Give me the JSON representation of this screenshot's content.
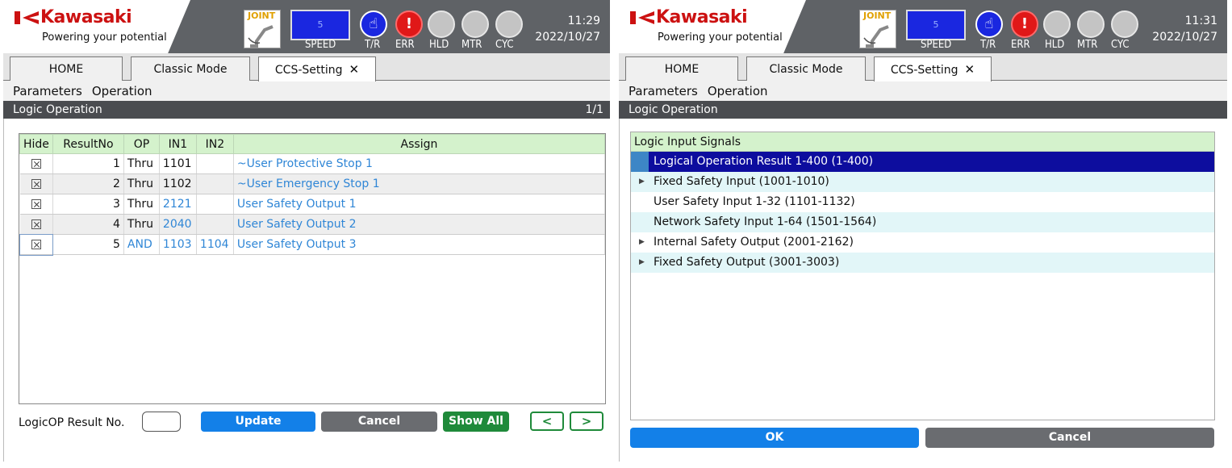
{
  "left": {
    "brand": "Kawasaki",
    "tagline": "Powering your potential",
    "joint_label": "JOINT",
    "speed_value": "5",
    "status_labels": {
      "speed": "SPEED",
      "tr": "T/R",
      "err": "ERR",
      "hld": "HLD",
      "mtr": "MTR",
      "cyc": "CYC"
    },
    "time": "11:29",
    "date": "2022/10/27",
    "tabs": [
      {
        "label": "HOME"
      },
      {
        "label": "Classic Mode"
      },
      {
        "label": "CCS-Setting",
        "close": "✕"
      }
    ],
    "menu": [
      "Parameters",
      "Operation"
    ],
    "section_title": "Logic Operation",
    "page_indicator": "1/1",
    "table": {
      "headers": [
        "Hide",
        "ResultNo",
        "OP",
        "IN1",
        "IN2",
        "Assign"
      ],
      "rows": [
        {
          "result": "1",
          "op": "Thru",
          "in1": "1101",
          "in2": "",
          "assign": "~User Protective Stop 1"
        },
        {
          "result": "2",
          "op": "Thru",
          "in1": "1102",
          "in2": "",
          "assign": "~User Emergency Stop 1"
        },
        {
          "result": "3",
          "op": "Thru",
          "in1": "2121",
          "in2": "",
          "assign": "User Safety Output 1"
        },
        {
          "result": "4",
          "op": "Thru",
          "in1": "2040",
          "in2": "",
          "assign": "User Safety Output 2"
        },
        {
          "result": "5",
          "op": "AND",
          "in1": "1103",
          "in2": "1104",
          "assign": "User Safety Output 3"
        }
      ]
    },
    "result_label": "LogicOP Result No.",
    "result_value": "",
    "buttons": {
      "update": "Update",
      "cancel": "Cancel",
      "show_all": "Show All",
      "prev": "<",
      "next": ">"
    }
  },
  "right": {
    "brand": "Kawasaki",
    "tagline": "Powering your potential",
    "joint_label": "JOINT",
    "speed_value": "5",
    "status_labels": {
      "speed": "SPEED",
      "tr": "T/R",
      "err": "ERR",
      "hld": "HLD",
      "mtr": "MTR",
      "cyc": "CYC"
    },
    "time": "11:31",
    "date": "2022/10/27",
    "tabs": [
      {
        "label": "HOME"
      },
      {
        "label": "Classic Mode"
      },
      {
        "label": "CCS-Setting",
        "close": "✕"
      }
    ],
    "menu": [
      "Parameters",
      "Operation"
    ],
    "section_title": "Logic Operation",
    "tree_title": "Logic Input Signals",
    "tree_items": [
      {
        "label": "Logical Operation Result 1-400 (1-400)",
        "expandable": false
      },
      {
        "label": "Fixed Safety Input (1001-1010)",
        "expandable": true
      },
      {
        "label": "User Safety Input 1-32 (1101-1132)",
        "expandable": false
      },
      {
        "label": "Network Safety Input 1-64 (1501-1564)",
        "expandable": false
      },
      {
        "label": "Internal Safety Output (2001-2162)",
        "expandable": true
      },
      {
        "label": "Fixed Safety Output (3001-3003)",
        "expandable": true
      }
    ],
    "buttons": {
      "ok": "OK",
      "cancel": "Cancel"
    }
  },
  "colors": {
    "brand_red": "#cc1111",
    "header_gray": "#5f6266",
    "table_header_green": "#d4f2cc",
    "link_blue": "#2f86d6",
    "selection_navy": "#0d0d9e"
  },
  "icons": [
    "kawasaki-logo-icon",
    "robot-arm-icon",
    "hand-icon",
    "exclamation-icon",
    "close-icon",
    "expand-arrow-icon"
  ]
}
